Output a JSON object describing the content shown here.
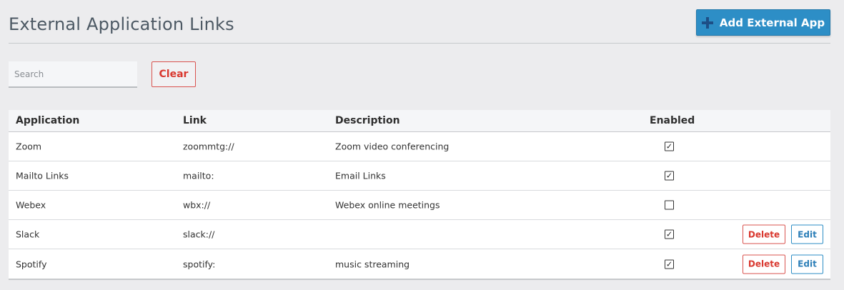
{
  "page": {
    "title": "External Application Links",
    "add_button_label": "Add External App",
    "add_button_icon": "plus-icon",
    "accent_color": "#2d8ec6",
    "danger_color": "#d9382f"
  },
  "search": {
    "placeholder": "Search",
    "value": "",
    "clear_label": "Clear"
  },
  "table": {
    "headers": {
      "application": "Application",
      "link": "Link",
      "description": "Description",
      "enabled": "Enabled"
    },
    "rows": [
      {
        "application": "Zoom",
        "link": "zoommtg://",
        "description": "Zoom video conferencing",
        "enabled": true,
        "actions": false
      },
      {
        "application": "Mailto Links",
        "link": "mailto:",
        "description": "Email Links",
        "enabled": true,
        "actions": false
      },
      {
        "application": "Webex",
        "link": "wbx://",
        "description": "Webex online meetings",
        "enabled": false,
        "actions": false
      },
      {
        "application": "Slack",
        "link": "slack://",
        "description": "",
        "enabled": true,
        "actions": true
      },
      {
        "application": "Spotify",
        "link": "spotify:",
        "description": "music streaming",
        "enabled": true,
        "actions": true
      }
    ],
    "delete_label": "Delete",
    "edit_label": "Edit"
  }
}
